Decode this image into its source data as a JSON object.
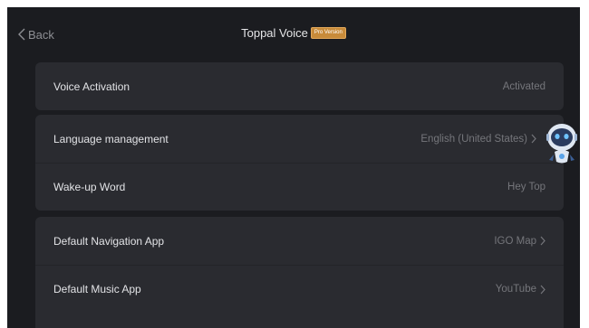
{
  "header": {
    "back_label": "Back",
    "title": "Toppal Voice",
    "badge": "Pro Version"
  },
  "sections": [
    {
      "rows": [
        {
          "label": "Voice Activation",
          "value": "Activated"
        }
      ]
    },
    {
      "rows": [
        {
          "label": "Language management",
          "value": "English (United States)"
        },
        {
          "label": "Wake-up Word",
          "value": "Hey Top"
        }
      ]
    },
    {
      "rows": [
        {
          "label": "Default Navigation App",
          "value": "IGO Map"
        },
        {
          "label": "Default Music App",
          "value": "YouTube"
        }
      ]
    }
  ],
  "colors": {
    "background": "#1b1c20",
    "card": "#2a2b30",
    "badge": "#c88b3a",
    "assistant": "#5aa3e8"
  },
  "icons": {
    "back": "chevron-left-icon",
    "row_arrow": "chevron-right-icon",
    "assistant": "robot-assistant-icon"
  }
}
